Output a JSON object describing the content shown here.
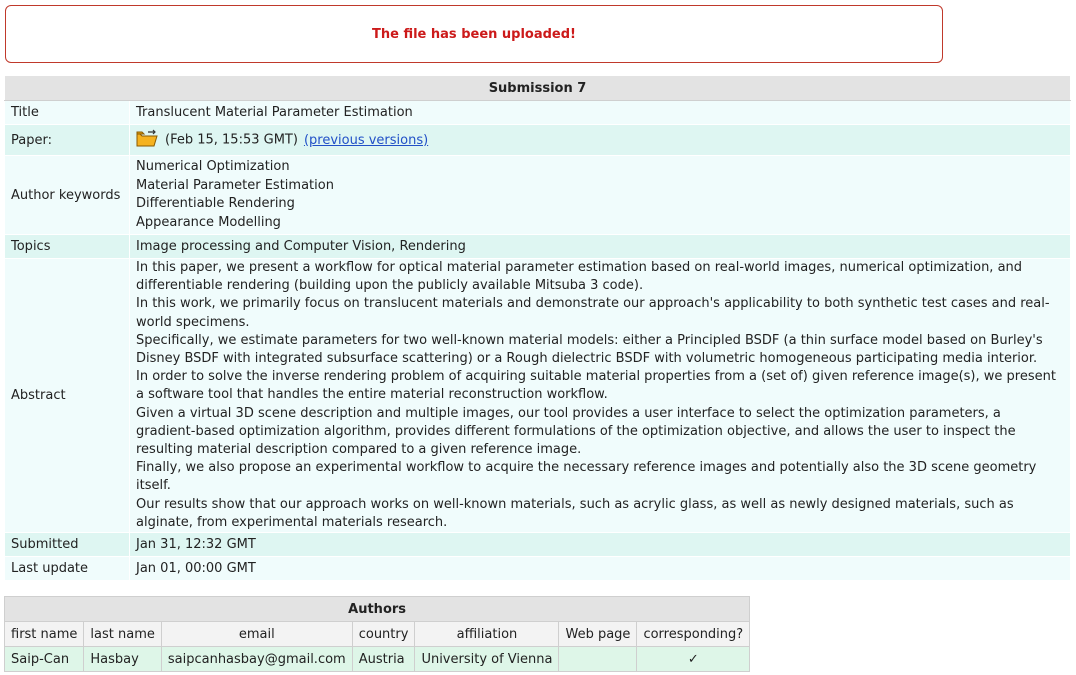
{
  "notice": {
    "message": "The file has been uploaded!"
  },
  "submission": {
    "heading": "Submission 7",
    "title_label": "Title",
    "title": "Translucent Material Parameter Estimation",
    "paper_label": "Paper:",
    "paper_date": "(Feb 15, 15:53 GMT)",
    "previous_versions": "(previous versions)",
    "keywords_label": "Author keywords",
    "keywords": [
      "Numerical Optimization",
      "Material Parameter Estimation",
      "Differentiable Rendering",
      "Appearance Modelling"
    ],
    "topics_label": "Topics",
    "topics": "Image processing and Computer Vision, Rendering",
    "abstract_label": "Abstract",
    "abstract": [
      "In this paper, we present a workflow for optical material parameter estimation based on real-world images, numerical optimization, and differentiable rendering (building upon the publicly available Mitsuba 3 code).",
      "In this work, we primarily focus on translucent materials and demonstrate our approach's applicability to both synthetic test cases and real-world specimens.",
      "Specifically, we estimate parameters for two well-known material models: either a Principled BSDF (a thin surface model based on Burley's Disney BSDF with integrated subsurface scattering) or a Rough dielectric BSDF with volumetric homogeneous participating media interior.",
      "In order to solve the inverse rendering problem of acquiring suitable material properties from a (set of) given reference image(s), we present a software tool that handles the entire material reconstruction workflow.",
      "Given a virtual 3D scene description and multiple images, our tool provides a user interface to select the optimization parameters, a gradient-based optimization algorithm, provides different formulations of the optimization objective, and allows the user to inspect the resulting material description compared to a given reference image.",
      "Finally, we also propose an experimental workflow to acquire the necessary reference images and potentially also the 3D scene geometry itself.",
      "Our results show that our approach works on well-known materials, such as acrylic glass, as well as newly designed materials, such as alginate, from experimental materials research."
    ],
    "submitted_label": "Submitted",
    "submitted": "Jan 31, 12:32 GMT",
    "last_update_label": "Last update",
    "last_update": "Jan 01, 00:00 GMT"
  },
  "authors": {
    "heading": "Authors",
    "columns": [
      "first name",
      "last name",
      "email",
      "country",
      "affiliation",
      "Web page",
      "corresponding?"
    ],
    "rows": [
      [
        "Saip-Can",
        "Hasbay",
        "saipcanhasbay@gmail.com",
        "Austria",
        "University of Vienna",
        "",
        "✓"
      ]
    ]
  },
  "icons": {
    "paper": "folder-icon"
  },
  "colors": {
    "notice_text": "#cc1a1a",
    "notice_border": "#c0392b",
    "link": "#2150c7"
  }
}
